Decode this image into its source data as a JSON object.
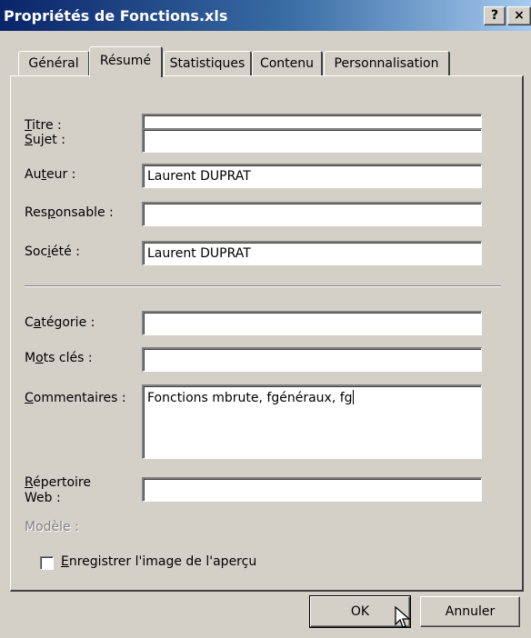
{
  "window": {
    "title": "Propriétés de Fonctions.xls",
    "help_label": "?",
    "close_label": "×"
  },
  "tabs": [
    {
      "label": "Général",
      "active": false
    },
    {
      "label": "Résumé",
      "active": true
    },
    {
      "label": "Statistiques",
      "active": false
    },
    {
      "label": "Contenu",
      "active": false
    },
    {
      "label": "Personnalisation",
      "active": false
    }
  ],
  "fields": {
    "titre": {
      "label_pre": "",
      "label_u": "T",
      "label_post": "itre :",
      "value": ""
    },
    "sujet": {
      "label_pre": "",
      "label_u": "S",
      "label_post": "ujet :",
      "value": ""
    },
    "auteur": {
      "label_pre": "Au",
      "label_u": "t",
      "label_post": "eur :",
      "value": "Laurent DUPRAT"
    },
    "responsable": {
      "label_pre": "Res",
      "label_u": "p",
      "label_post": "onsable :",
      "value": ""
    },
    "societe": {
      "label_pre": "Soc",
      "label_u": "i",
      "label_post": "été :",
      "value": "Laurent DUPRAT"
    },
    "categorie": {
      "label_pre": "C",
      "label_u": "a",
      "label_post": "tégorie :",
      "value": ""
    },
    "mots_cles": {
      "label_pre": "M",
      "label_u": "o",
      "label_post": "ts clés :",
      "value": ""
    },
    "commentaires": {
      "label_pre": "",
      "label_u": "C",
      "label_post": "ommentaires :",
      "value": "Fonctions mbrute, fgénéraux, fg"
    },
    "repertoire": {
      "label_u": "R",
      "label_line1": "épertoire",
      "label_line2": "Web :",
      "value": ""
    }
  },
  "modele_label": "Modèle :",
  "checkbox": {
    "label_u": "E",
    "label_post": "nregistrer l'image de l'aperçu",
    "checked": false
  },
  "buttons": {
    "ok": "OK",
    "cancel": "Annuler"
  }
}
